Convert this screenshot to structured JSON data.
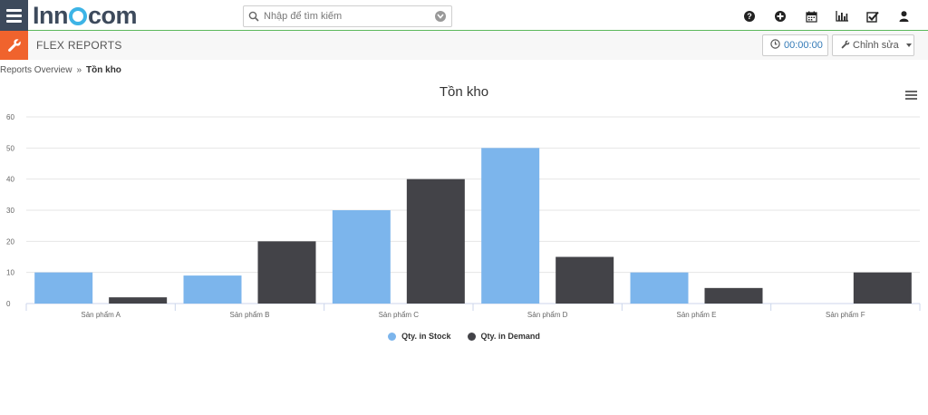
{
  "app": {
    "logo_prefix": "Inn",
    "logo_suffix": "com"
  },
  "search": {
    "placeholder": "Nhập để tìm kiếm"
  },
  "top_icons": [
    "help-icon",
    "plus-circle-icon",
    "calendar-icon",
    "bar-chart-icon",
    "checkbox-icon",
    "user-icon"
  ],
  "subbar": {
    "title": "FLEX REPORTS",
    "timer": "00:00:00",
    "edit_label": "Chỉnh sửa"
  },
  "breadcrumb": {
    "parent": "Reports Overview",
    "separator": "»",
    "current": "Tồn kho"
  },
  "colors": {
    "stock": "#7cb5ec",
    "demand": "#434348",
    "accent": "#f0632d",
    "nav": "#3d4a5c"
  },
  "chart_data": {
    "type": "bar",
    "title": "Tồn kho",
    "categories": [
      "Sản phẩm A",
      "Sản phẩm B",
      "Sản phẩm C",
      "Sản phẩm D",
      "Sản phẩm E",
      "Sản phẩm F"
    ],
    "series": [
      {
        "name": "Qty. in Stock",
        "values": [
          10,
          9,
          30,
          50,
          10,
          0
        ]
      },
      {
        "name": "Qty. in Demand",
        "values": [
          2,
          20,
          40,
          15,
          5,
          10
        ]
      }
    ],
    "yticks": [
      0,
      10,
      20,
      30,
      40,
      50,
      60
    ],
    "ylim": [
      0,
      60
    ],
    "grid": true,
    "legend": "bottom-center"
  }
}
